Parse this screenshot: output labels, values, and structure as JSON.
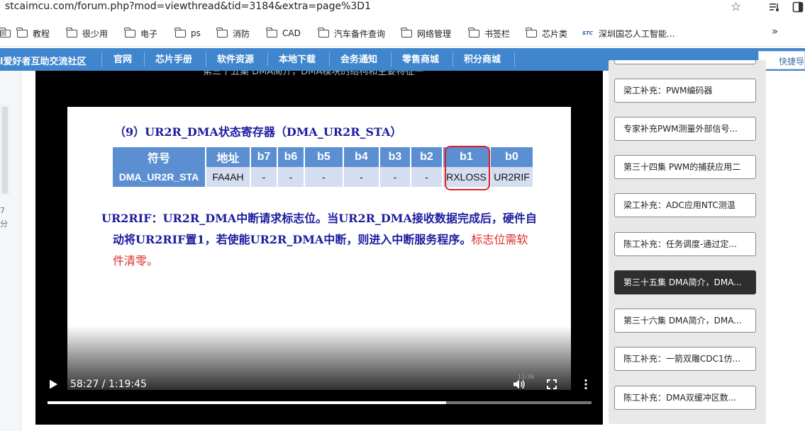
{
  "browser": {
    "url": "stcaimcu.com/forum.php?mod=viewthread&tid=3184&extra=page%3D1"
  },
  "bookmarks": [
    {
      "label": "教程"
    },
    {
      "label": "很少用"
    },
    {
      "label": "电子"
    },
    {
      "label": "ps"
    },
    {
      "label": "消防"
    },
    {
      "label": "CAD"
    },
    {
      "label": "汽车备件查询"
    },
    {
      "label": "网络管理"
    },
    {
      "label": "书签栏"
    },
    {
      "label": "芯片类"
    },
    {
      "label": "深圳国芯人工智能...",
      "logo": "STC"
    }
  ],
  "site": {
    "title": "l爱好者互助交流社区",
    "nav": [
      "官网",
      "芯片手册",
      "软件资源",
      "本地下载",
      "会务通知",
      "零售商城",
      "积分商城"
    ],
    "quick_nav": "快捷导"
  },
  "left_strip": {
    "line1": "7",
    "line2": "分",
    "top_char": "≡"
  },
  "video": {
    "ghost_title": "第三十五集 DMA简介，DMA模块的结构和主要特征一",
    "slide": {
      "heading": "（9）UR2R_DMA状态寄存器（DMA_UR2R_STA）",
      "table_header": [
        "符号",
        "地址",
        "b7",
        "b6",
        "b5",
        "b4",
        "b3",
        "b2",
        "b1",
        "b0"
      ],
      "table_row": [
        "DMA_UR2R_STA",
        "FA4AH",
        "-",
        "-",
        "-",
        "-",
        "-",
        "-",
        "RXLOSS",
        "UR2RIF"
      ],
      "para_line1": "UR2RIF：UR2R_DMA中断请求标志位。当UR2R_DMA接收数据完成后，硬件自",
      "para_line2_blue": "动将UR2RIF置1，若使能UR2R_DMA中断，则进入中断服务程序。",
      "para_line2_red": "标志位需软",
      "para_line3_red": "件清零。",
      "page_num": "11/36"
    },
    "time": "58:27 / 1:19:45",
    "progress": 0.733
  },
  "playlist": {
    "items": [
      {
        "label": "梁工补充：PWM编码器",
        "active": false
      },
      {
        "label": "专家补充PWM测量外部信号...",
        "active": false
      },
      {
        "label": "第三十四集 PWM的捕获应用二",
        "active": false
      },
      {
        "label": "梁工补充：ADC应用NTC测温",
        "active": false
      },
      {
        "label": "陈工补充：任务调度-通过定...",
        "active": false
      },
      {
        "label": "第三十五集 DMA简介，DMA...",
        "active": true
      },
      {
        "label": "第三十六集 DMA简介，DMA...",
        "active": false
      },
      {
        "label": "陈工补充：一箭双雕CDC1仿...",
        "active": false
      },
      {
        "label": "陈工补充：DMA双缓冲区数...",
        "active": false
      }
    ]
  },
  "colors": {
    "nav_bg": "#3f86ce",
    "active_item": "#2e2e2e",
    "slide_blue": "#1c1c9e",
    "slide_red": "#e02a2a",
    "table_header": "#5b8fd2"
  }
}
